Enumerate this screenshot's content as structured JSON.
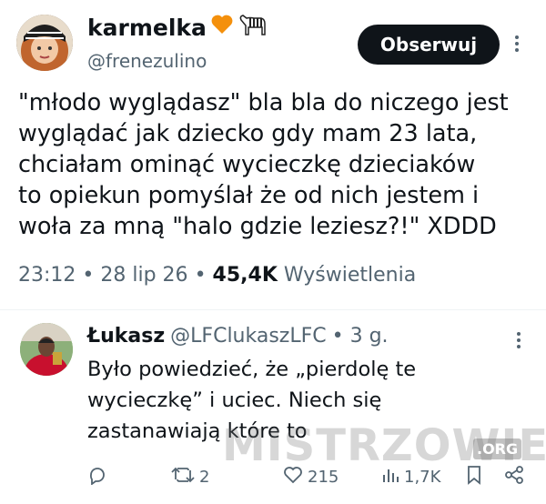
{
  "post": {
    "author_name": "karmelka",
    "author_handle": "@frenezulino",
    "follow_label": "Obserwuj",
    "text": "\"młodo wyglądasz\" bla bla do niczego jest\nwyglądać jak dziecko gdy mam 23 lata,\nchciałam ominąć wycieczkę dzieciaków\nto opiekun pomyślał że od nich jestem i\nwoła za mną \"halo gdzie leziesz?!\" XDDD",
    "time": "23:12",
    "date": "28 lip 26",
    "views_count": "45,4K",
    "views_label": "Wyświetlenia",
    "sep": "•"
  },
  "reply": {
    "author_name": "Łukasz",
    "author_handle": "@LFClukaszLFC",
    "age": "• 3 g.",
    "text": "Było powiedzieć, że „pierdolę te\nwycieczkę” i uciec. Niech się\nzastanawiają które to",
    "retweets": "2",
    "likes": "215",
    "views": "1,7K"
  },
  "watermark": {
    "text": "MISTRZOWIE",
    "suffix": ".ORG"
  },
  "colors": {
    "text": "#0f1419",
    "muted": "#536471",
    "heart": "#f4900c"
  }
}
